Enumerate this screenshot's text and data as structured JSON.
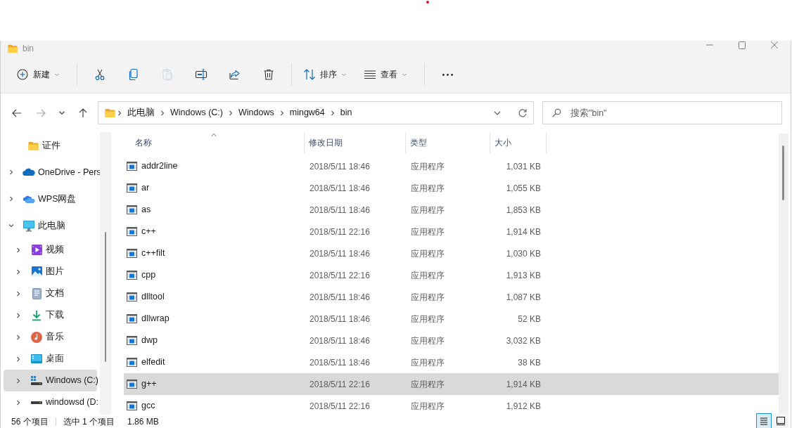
{
  "window": {
    "title": "bin"
  },
  "toolbar": [
    {
      "kind": "new",
      "label": "新建",
      "disabled": false
    },
    {
      "kind": "cut",
      "disabled": false
    },
    {
      "kind": "copy",
      "disabled": false
    },
    {
      "kind": "paste",
      "disabled": true
    },
    {
      "kind": "rename",
      "disabled": false
    },
    {
      "kind": "share",
      "disabled": false
    },
    {
      "kind": "delete",
      "disabled": false
    },
    {
      "kind": "sort",
      "label": "排序",
      "disabled": false
    },
    {
      "kind": "view",
      "label": "查看",
      "disabled": false
    },
    {
      "kind": "more",
      "disabled": false
    }
  ],
  "navigation": {
    "buttons": [
      {
        "kind": "back",
        "disabled": false
      },
      {
        "kind": "forward",
        "disabled": true
      },
      {
        "kind": "recent",
        "disabled": false
      },
      {
        "kind": "up",
        "disabled": false
      }
    ],
    "breadcrumbs": [
      "此电脑",
      "Windows (C:)",
      "Windows",
      "mingw64",
      "bin"
    ],
    "search": {
      "placeholder": "搜索\"bin\""
    }
  },
  "sidebar": {
    "items": [
      {
        "label": "证件",
        "kind": "folder",
        "expandable": false,
        "selected": false
      },
      {
        "label": "OneDrive - Pers",
        "kind": "onedrive",
        "expandable": true,
        "expanded": false,
        "selected": false
      },
      {
        "label": "WPS网盘",
        "kind": "cloud",
        "expandable": true,
        "expanded": false,
        "selected": false
      },
      {
        "label": "此电脑",
        "kind": "pc",
        "expandable": true,
        "expanded": true,
        "selected": false,
        "children": [
          {
            "label": "视频",
            "kind": "video",
            "expandable": true,
            "expanded": false,
            "selected": false
          },
          {
            "label": "图片",
            "kind": "pictures",
            "expandable": true,
            "expanded": false,
            "selected": false
          },
          {
            "label": "文档",
            "kind": "documents",
            "expandable": true,
            "expanded": false,
            "selected": false
          },
          {
            "label": "下载",
            "kind": "download",
            "expandable": true,
            "expanded": false,
            "selected": false
          },
          {
            "label": "音乐",
            "kind": "music",
            "expandable": true,
            "expanded": false,
            "selected": false
          },
          {
            "label": "桌面",
            "kind": "desktop",
            "expandable": true,
            "expanded": false,
            "selected": false
          },
          {
            "label": "Windows (C:)",
            "kind": "system_drive",
            "expandable": true,
            "expanded": false,
            "selected": true
          },
          {
            "label": "windowsd (D:",
            "kind": "drive",
            "expandable": true,
            "expanded": false,
            "selected": false
          }
        ]
      }
    ]
  },
  "table": {
    "columns": [
      {
        "label": "名称",
        "sorted": true
      },
      {
        "label": "修改日期",
        "sorted": false
      },
      {
        "label": "类型",
        "sorted": false
      },
      {
        "label": "大小",
        "sorted": false
      }
    ],
    "rows": [
      {
        "name": "addr2line",
        "modified": "2018/5/11 18:46",
        "type": "应用程序",
        "size": "1,031 KB",
        "selected": false
      },
      {
        "name": "ar",
        "modified": "2018/5/11 18:46",
        "type": "应用程序",
        "size": "1,055 KB",
        "selected": false
      },
      {
        "name": "as",
        "modified": "2018/5/11 18:46",
        "type": "应用程序",
        "size": "1,853 KB",
        "selected": false
      },
      {
        "name": "c++",
        "modified": "2018/5/11 22:16",
        "type": "应用程序",
        "size": "1,914 KB",
        "selected": false
      },
      {
        "name": "c++filt",
        "modified": "2018/5/11 18:46",
        "type": "应用程序",
        "size": "1,030 KB",
        "selected": false
      },
      {
        "name": "cpp",
        "modified": "2018/5/11 22:16",
        "type": "应用程序",
        "size": "1,913 KB",
        "selected": false
      },
      {
        "name": "dlltool",
        "modified": "2018/5/11 18:46",
        "type": "应用程序",
        "size": "1,087 KB",
        "selected": false
      },
      {
        "name": "dllwrap",
        "modified": "2018/5/11 18:46",
        "type": "应用程序",
        "size": "52 KB",
        "selected": false
      },
      {
        "name": "dwp",
        "modified": "2018/5/11 18:46",
        "type": "应用程序",
        "size": "3,032 KB",
        "selected": false
      },
      {
        "name": "elfedit",
        "modified": "2018/5/11 18:46",
        "type": "应用程序",
        "size": "38 KB",
        "selected": false
      },
      {
        "name": "g++",
        "modified": "2018/5/11 22:16",
        "type": "应用程序",
        "size": "1,914 KB",
        "selected": true
      },
      {
        "name": "gcc",
        "modified": "2018/5/11 22:16",
        "type": "应用程序",
        "size": "1,912 KB",
        "selected": false
      }
    ]
  },
  "status_bar": {
    "item_count": "56 个项目",
    "selection": "选中 1 个项目",
    "selection_size": "1.86 MB",
    "views": [
      {
        "kind": "details",
        "selected": true
      },
      {
        "kind": "tiles",
        "selected": false
      }
    ]
  }
}
